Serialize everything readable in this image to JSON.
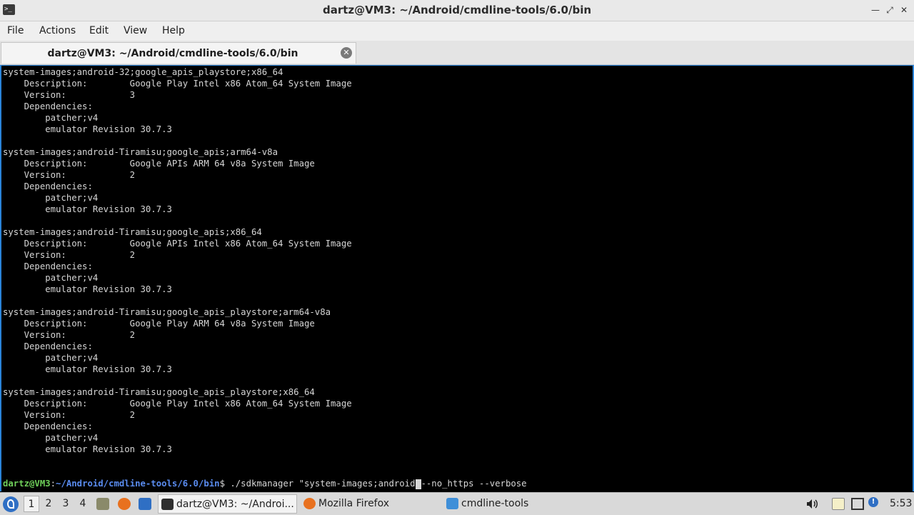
{
  "window": {
    "title": "dartz@VM3: ~/Android/cmdline-tools/6.0/bin"
  },
  "menu": [
    "File",
    "Actions",
    "Edit",
    "View",
    "Help"
  ],
  "tab": {
    "label": "dartz@VM3: ~/Android/cmdline-tools/6.0/bin"
  },
  "terminal": {
    "lines": [
      "system-images;android-32;google_apis_playstore;x86_64",
      "    Description:        Google Play Intel x86 Atom_64 System Image",
      "    Version:            3",
      "    Dependencies:",
      "        patcher;v4",
      "        emulator Revision 30.7.3",
      "",
      "system-images;android-Tiramisu;google_apis;arm64-v8a",
      "    Description:        Google APIs ARM 64 v8a System Image",
      "    Version:            2",
      "    Dependencies:",
      "        patcher;v4",
      "        emulator Revision 30.7.3",
      "",
      "system-images;android-Tiramisu;google_apis;x86_64",
      "    Description:        Google APIs Intel x86 Atom_64 System Image",
      "    Version:            2",
      "    Dependencies:",
      "        patcher;v4",
      "        emulator Revision 30.7.3",
      "",
      "system-images;android-Tiramisu;google_apis_playstore;arm64-v8a",
      "    Description:        Google Play ARM 64 v8a System Image",
      "    Version:            2",
      "    Dependencies:",
      "        patcher;v4",
      "        emulator Revision 30.7.3",
      "",
      "system-images;android-Tiramisu;google_apis_playstore;x86_64",
      "    Description:        Google Play Intel x86 Atom_64 System Image",
      "    Version:            2",
      "    Dependencies:",
      "        patcher;v4",
      "        emulator Revision 30.7.3"
    ],
    "prompt_user": "dartz@VM3",
    "prompt_sep": ":",
    "prompt_path": "~/Android/cmdline-tools/6.0/bin",
    "prompt_dollar": "$ ",
    "command_before_cursor": "./sdkmanager \"system-images;android",
    "command_after_cursor": "--no_https --verbose"
  },
  "taskbar": {
    "workspaces": [
      "1",
      "2",
      "3",
      "4"
    ],
    "tasks": [
      {
        "label": "dartz@VM3: ~/Androi...",
        "icon": "terminal-icon"
      },
      {
        "label": "Mozilla Firefox",
        "icon": "firefox-icon"
      },
      {
        "label": "cmdline-tools",
        "icon": "folder-icon"
      }
    ],
    "clock": "5:53"
  },
  "colors": {
    "prompt_user": "#6fcf5a",
    "prompt_path": "#5a8cf0",
    "terminal_bg": "#000000",
    "terminal_fg": "#d6d6d6",
    "focus_border": "#2a83d8"
  }
}
